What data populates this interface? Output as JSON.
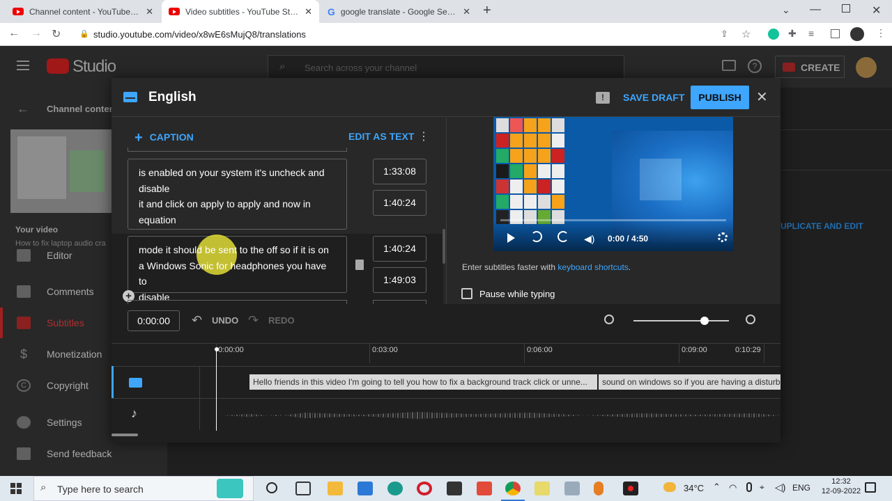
{
  "browser": {
    "tabs": [
      {
        "title": "Channel content - YouTube Studio",
        "active": false
      },
      {
        "title": "Video subtitles - YouTube Studio",
        "active": true
      },
      {
        "title": "google translate - Google Search",
        "active": false
      }
    ],
    "new_tab": "+",
    "url": "studio.youtube.com/video/x8wE6sMujQ8/translations"
  },
  "studio": {
    "logo_text": "Studio",
    "search_placeholder": "Search across your channel",
    "create_label": "CREATE"
  },
  "sidebar": {
    "channel_label": "Channel conten",
    "your_video_label": "Your video",
    "video_title": "How to fix laptop audio cra",
    "items": [
      {
        "label": "Editor"
      },
      {
        "label": "Comments"
      },
      {
        "label": "Subtitles"
      },
      {
        "label": "Monetization"
      },
      {
        "label": "Copyright"
      },
      {
        "label": "Settings"
      },
      {
        "label": "Send feedback"
      }
    ]
  },
  "background": {
    "duplicate_label": "UPLICATE AND EDIT"
  },
  "modal": {
    "title": "English",
    "save_draft": "SAVE DRAFT",
    "publish": "PUBLISH",
    "caption_button": "CAPTION",
    "edit_as_text": "EDIT AS TEXT",
    "captions": [
      {
        "lines": [
          "is enabled on your system it's uncheck and",
          "disable",
          "it and click on apply to apply and now in",
          "equation"
        ],
        "start": "1:33:08",
        "end": "1:40:24"
      },
      {
        "lines": [
          "mode it should be sent to the off so if it is on",
          "a Windows Sonic for headphones you have to",
          "disable"
        ],
        "start": "1:40:24",
        "end": "1:49:03"
      }
    ],
    "player_time": "0:00 / 4:50",
    "shortcut_hint_prefix": "Enter subtitles faster with ",
    "shortcut_link": "keyboard shortcuts",
    "shortcut_hint_suffix": ".",
    "pause_label": "Pause while typing",
    "current_time": "0:00:00",
    "undo": "UNDO",
    "redo": "REDO",
    "ruler": [
      "0:00:00",
      "0:03:00",
      "0:06:00",
      "0:09:00",
      "0:10:29"
    ],
    "segments": [
      "Hello friends in this video I'm going to tell you  how to fix a background track click or unne...",
      "sound on windows so if you are having a disturb"
    ]
  },
  "taskbar": {
    "search_placeholder": "Type here to search",
    "temperature": "34°C",
    "language": "ENG",
    "time": "12:32",
    "date": "12-09-2022"
  },
  "colors": {
    "accent": "#3ea6ff",
    "publish_bg": "#3ea6ff",
    "highlight": "#e8e337"
  }
}
